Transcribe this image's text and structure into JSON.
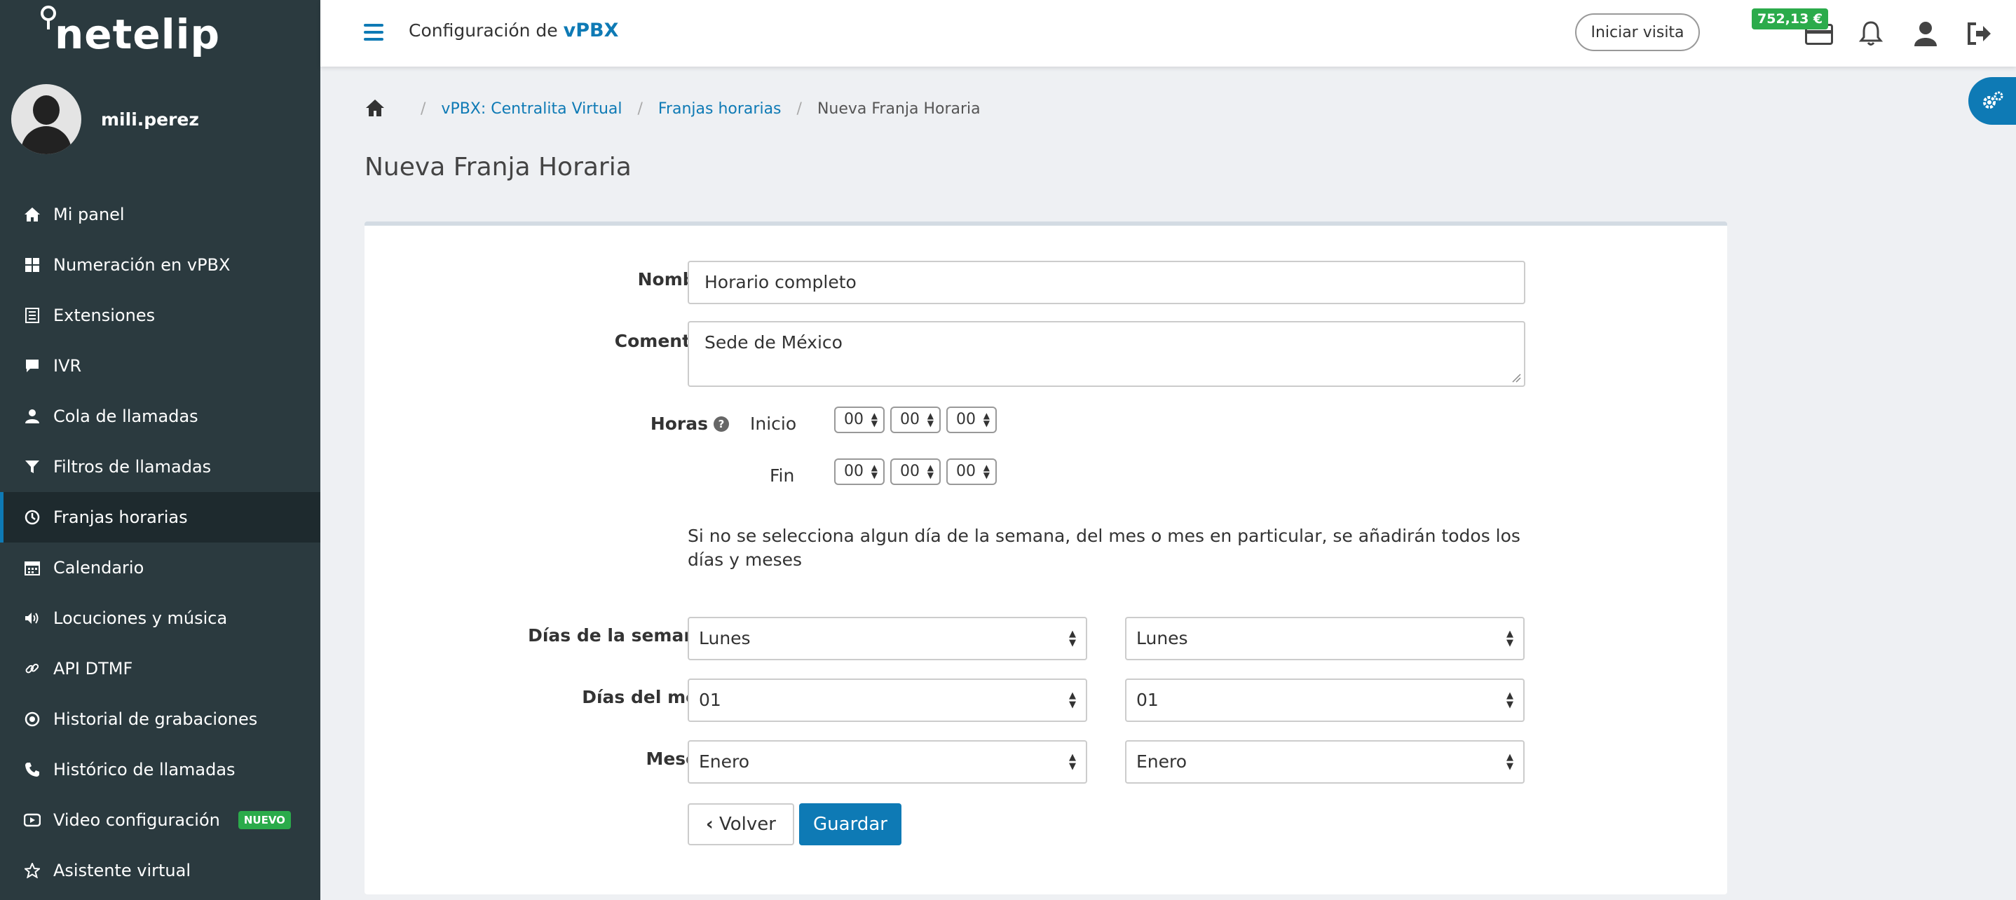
{
  "brand": {
    "logo_text": "netelip"
  },
  "user": {
    "name": "mili.perez"
  },
  "sidebar": {
    "items": [
      {
        "label": "Mi panel",
        "icon": "home-icon"
      },
      {
        "label": "Numeración en vPBX",
        "icon": "grid-icon"
      },
      {
        "label": "Extensiones",
        "icon": "list-icon"
      },
      {
        "label": "IVR",
        "icon": "chat-icon"
      },
      {
        "label": "Cola de llamadas",
        "icon": "user-icon"
      },
      {
        "label": "Filtros de llamadas",
        "icon": "filter-icon"
      },
      {
        "label": "Franjas horarias",
        "icon": "clock-icon",
        "active": true
      },
      {
        "label": "Calendario",
        "icon": "calendar-icon"
      },
      {
        "label": "Locuciones y música",
        "icon": "volume-icon"
      },
      {
        "label": "API DTMF",
        "icon": "link-icon"
      },
      {
        "label": "Historial de grabaciones",
        "icon": "record-icon"
      },
      {
        "label": "Histórico de llamadas",
        "icon": "phone-icon"
      },
      {
        "label": "Video configuración",
        "icon": "video-icon",
        "badge": "NUEVO"
      },
      {
        "label": "Asistente virtual",
        "icon": "star-icon"
      }
    ]
  },
  "header": {
    "title_prefix": "Configuración de",
    "title_strong": "vPBX",
    "visit_button": "Iniciar visita",
    "balance": "752,13 €"
  },
  "breadcrumb": {
    "items": [
      "vPBX: Centralita Virtual",
      "Franjas horarias"
    ],
    "current": "Nueva Franja Horaria",
    "separator": "/"
  },
  "page": {
    "title": "Nueva Franja Horaria"
  },
  "form": {
    "nombre": {
      "label": "Nombre",
      "required_mark": "*",
      "value": "Horario completo"
    },
    "comentario": {
      "label": "Comentario",
      "value": "Sede de México"
    },
    "horas": {
      "label": "Horas",
      "inicio_label": "Inicio",
      "fin_label": "Fin",
      "inicio": [
        "00",
        "00",
        "00"
      ],
      "fin": [
        "00",
        "00",
        "00"
      ]
    },
    "note": "Si no se selecciona algun día de la semana, del mes o mes en particular, se añadirán todos los días y meses",
    "dias_semana": {
      "label": "Días de la semana",
      "from": "Lunes",
      "to": "Lunes"
    },
    "dias_mes": {
      "label": "Días del mes",
      "from": "01",
      "to": "01"
    },
    "meses": {
      "label": "Meses",
      "from": "Enero",
      "to": "Enero"
    },
    "back_button": "Volver",
    "save_button": "Guardar"
  },
  "colors": {
    "primary": "#0e7ab5",
    "sidebar": "#2b3a3f",
    "success": "#2bab4b"
  }
}
